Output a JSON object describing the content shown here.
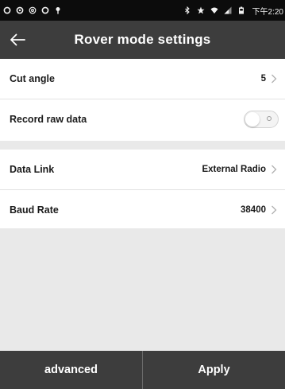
{
  "status_bar": {
    "time": "下午2:20",
    "left_icons": [
      "circle-status-icon",
      "circle-status-icon",
      "at-status-icon",
      "circle-status-icon",
      "location-pin-icon"
    ],
    "right_icons": [
      "bluetooth-icon",
      "star-icon",
      "wifi-icon",
      "signal-icon",
      "battery-icon"
    ]
  },
  "header": {
    "title": "Rover mode settings",
    "back_icon": "back-arrow-icon"
  },
  "settings": {
    "cut_angle": {
      "label": "Cut angle",
      "value": "5"
    },
    "record_raw_data": {
      "label": "Record raw data",
      "enabled": false
    },
    "data_link": {
      "label": "Data Link",
      "value": "External Radio"
    },
    "baud_rate": {
      "label": "Baud Rate",
      "value": "38400"
    }
  },
  "footer": {
    "advanced_label": "advanced",
    "apply_label": "Apply"
  },
  "colors": {
    "status_bar_bg": "#0c0c0c",
    "title_bar_bg": "#3d3d3d",
    "page_bg": "#e9e9e9",
    "row_bg": "#ffffff"
  }
}
